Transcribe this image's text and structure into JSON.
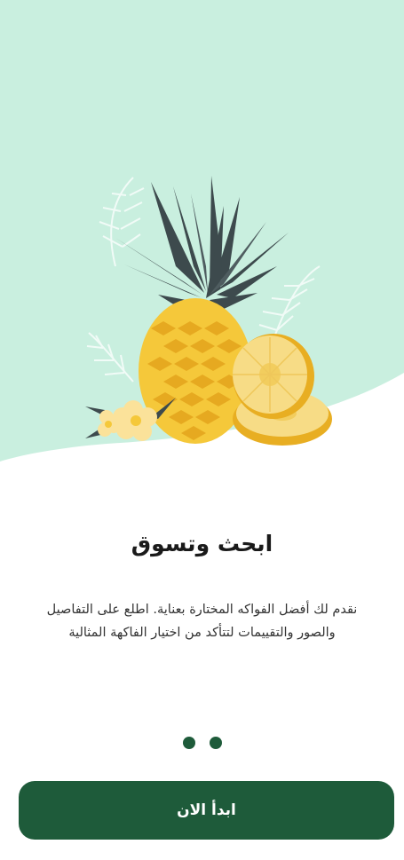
{
  "onboarding": {
    "title": "ابحث وتسوق",
    "description": "نقدم لك أفضل الفواكه المختارة بعناية. اطلع على التفاصيل والصور والتقييمات لتتأكد من اختيار الفاكهة المثالية",
    "pager": {
      "total": 2
    },
    "start_button_label": "ابدأ الان"
  },
  "colors": {
    "hero_background": "#c9efdf",
    "primary": "#1e5b3a",
    "pineapple": "#f5c83a",
    "leaves": "#3d4a4d"
  },
  "icons": {
    "hero": "pineapple-illustration"
  }
}
